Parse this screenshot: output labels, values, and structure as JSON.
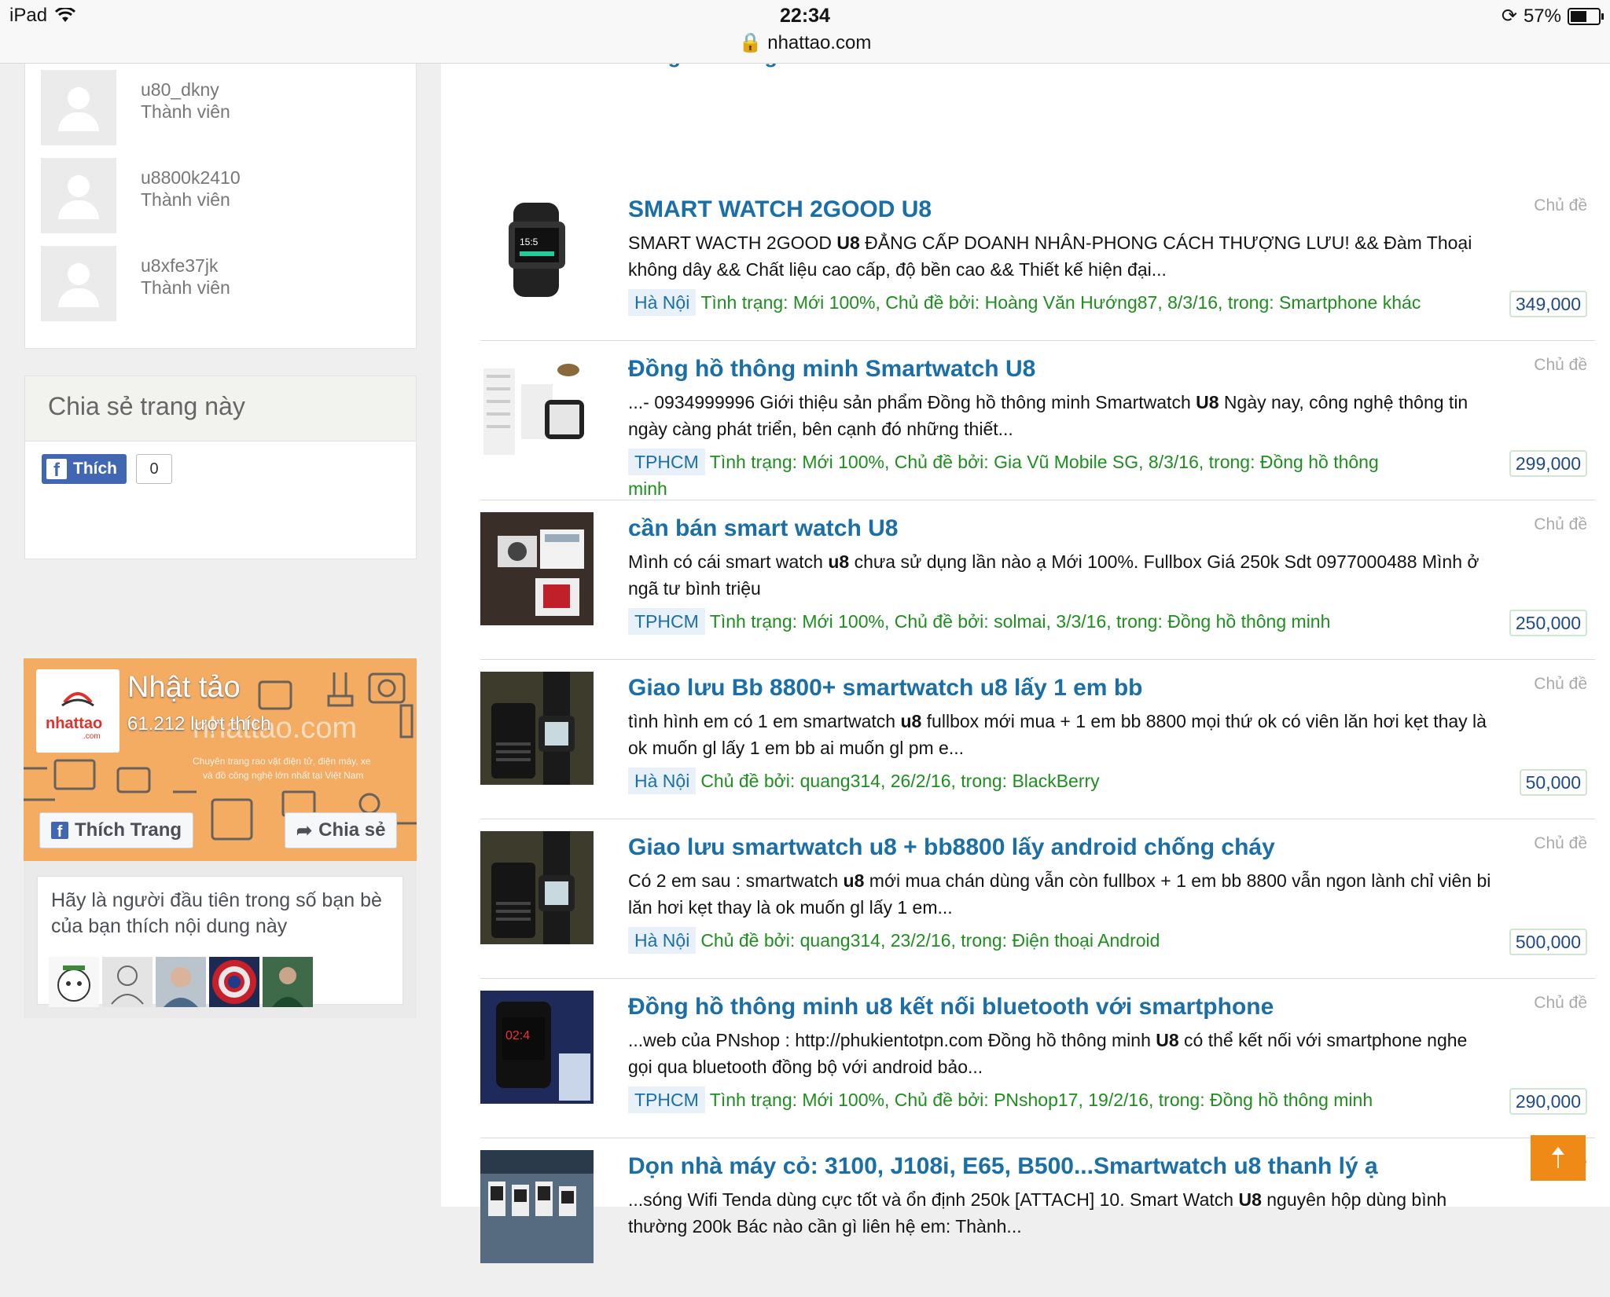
{
  "status_bar": {
    "device": "iPad",
    "time": "22:34",
    "url": "nhattao.com",
    "battery": "57%"
  },
  "sidebar": {
    "members": [
      {
        "name": "u80_dkny",
        "role": "Thành viên"
      },
      {
        "name": "u8800k2410",
        "role": "Thành viên"
      },
      {
        "name": "u8xfe37jk",
        "role": "Thành viên"
      }
    ],
    "share_heading": "Chia sẻ trang này",
    "like_label": "Thích",
    "like_count": "0"
  },
  "fb_page": {
    "name": "Nhật tảo",
    "likes": "61.212 lượt thích",
    "logo_text": "nhattao",
    "logo_suffix": ".com",
    "banner_text": "nhattao.com",
    "banner_sub1": "Chuyên trang rao vặt điện tử, điện máy, xe",
    "banner_sub2": "và đồ công nghệ lớn nhất tại Việt Nam",
    "like_page_label": "Thích Trang",
    "share_label": "Chia sẻ",
    "friends_text": "Hãy là người đầu tiên trong số bạn bè của bạn thích nội dung này"
  },
  "results": {
    "prev_title_fragment": "Đồng hồ thông minh",
    "items": [
      {
        "title": "SMART WATCH 2GOOD U8",
        "snippet_pre": "SMART WACTH 2GOOD ",
        "snippet_bold": "U8",
        "snippet_post": " ĐẲNG CẤP DOANH NHÂN-PHONG CÁCH THƯỢNG LƯU! && Đàm Thoại không dây && Chất liệu cao cấp, độ bền cao && Thiết kế hiện đại...",
        "location": "Hà Nội",
        "meta": "Tình trạng: Mới 100%, Chủ đề bởi: Hoàng Văn Hướng87, 8/3/16, trong: Smartphone khác",
        "price": "349,000",
        "kind": "Chủ đề"
      },
      {
        "title": "Đồng hồ thông minh Smartwatch U8",
        "snippet_pre": "...- 0934999996 Giới thiệu sản phẩm Đồng hồ thông minh Smartwatch ",
        "snippet_bold": "U8",
        "snippet_post": " Ngày nay, công nghệ thông tin ngày càng phát triển, bên cạnh đó những thiết...",
        "location": "TPHCM",
        "meta": "Tình trạng: Mới 100%, Chủ đề bởi: Gia Vũ Mobile SG, 8/3/16, trong: Đồng hồ thông minh",
        "price": "299,000",
        "kind": "Chủ đề"
      },
      {
        "title": "cần bán smart watch U8",
        "snippet_pre": "Mình có cái smart watch ",
        "snippet_bold": "u8",
        "snippet_post": " chưa sử dụng lần nào ạ Mới 100%. Fullbox Giá 250k Sdt 0977000488 Mình ở ngã tư bình triệu",
        "location": "TPHCM",
        "meta": "Tình trạng: Mới 100%, Chủ đề bởi: solmai, 3/3/16, trong: Đồng hồ thông minh",
        "price": "250,000",
        "kind": "Chủ đề"
      },
      {
        "title": "Giao lưu Bb 8800+ smartwatch u8 lấy 1 em bb",
        "snippet_pre": "tình hình em có 1 em smartwatch ",
        "snippet_bold": "u8",
        "snippet_post": " fullbox mới mua + 1 em bb 8800 mọi thứ ok có viên lăn hơi kẹt thay là ok muốn gl lấy 1 em bb ai muốn gl pm e...",
        "location": "Hà Nội",
        "meta": "Chủ đề bởi: quang314, 26/2/16, trong: BlackBerry",
        "price": "50,000",
        "kind": "Chủ đề"
      },
      {
        "title": "Giao lưu smartwatch u8 + bb8800 lấy android chống cháy",
        "snippet_pre": "Có 2 em sau : smartwatch ",
        "snippet_bold": "u8",
        "snippet_post": " mới mua chán dùng vẫn còn fullbox + 1 em bb 8800 vẫn ngon lành chỉ viên bi lăn hơi kẹt thay là ok muốn gl lấy 1 em...",
        "location": "Hà Nội",
        "meta": "Chủ đề bởi: quang314, 23/2/16, trong: Điện thoại Android",
        "price": "500,000",
        "kind": "Chủ đề"
      },
      {
        "title": "Đồng hồ thông minh u8 kết nối bluetooth với smartphone",
        "snippet_pre": "...web của PNshop : http://phukientotpn.com Đồng hồ thông minh ",
        "snippet_bold": "U8",
        "snippet_post": " có thể kết nối với smartphone nghe gọi qua bluetooth đồng bộ với android bảo...",
        "location": "TPHCM",
        "meta": "Tình trạng: Mới 100%, Chủ đề bởi: PNshop17, 19/2/16, trong: Đồng hồ thông minh",
        "price": "290,000",
        "kind": "Chủ đề"
      },
      {
        "title": "Dọn nhà máy cỏ: 3100, J108i, E65, B500...Smartwatch u8 thanh lý ạ",
        "snippet_pre": "...sóng Wifi Tenda dùng cực tốt và ổn định 250k [ATTACH] 10. Smart Watch ",
        "snippet_bold": "U8",
        "snippet_post": " nguyên hộp dùng bình thường 200k Bác nào cần gì liên hệ em: Thành...",
        "location": "",
        "meta": "",
        "price": "",
        "kind": "Chủ đề"
      }
    ]
  },
  "scroll_top_icon": "arrow-up-icon"
}
